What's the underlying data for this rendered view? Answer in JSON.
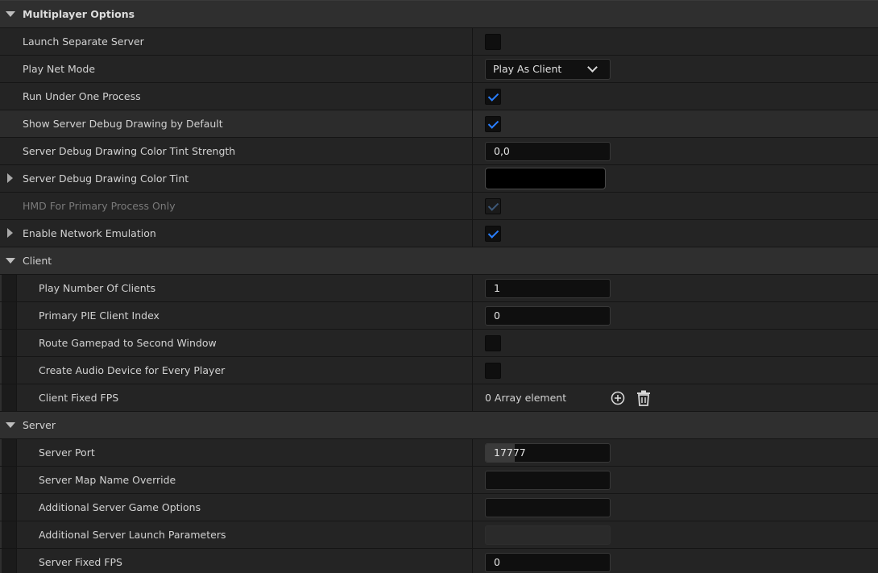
{
  "sections": {
    "multiplayer": {
      "title": "Multiplayer Options",
      "launch_separate_server": {
        "label": "Launch Separate Server",
        "checked": false
      },
      "play_net_mode": {
        "label": "Play Net Mode",
        "value": "Play As Client"
      },
      "run_under_one_process": {
        "label": "Run Under One Process",
        "checked": true
      },
      "show_server_debug_drawing": {
        "label": "Show Server Debug Drawing by Default",
        "checked": true
      },
      "debug_tint_strength": {
        "label": "Server Debug Drawing Color Tint Strength",
        "value": "0,0"
      },
      "debug_tint": {
        "label": "Server Debug Drawing Color Tint",
        "color": "#000000"
      },
      "hmd_primary_only": {
        "label": "HMD For Primary Process Only",
        "checked": true
      },
      "network_emulation": {
        "label": "Enable Network Emulation",
        "checked": true
      }
    },
    "client": {
      "title": "Client",
      "play_number_of_clients": {
        "label": "Play Number Of Clients",
        "value": "1"
      },
      "primary_pie_client_index": {
        "label": "Primary PIE Client Index",
        "value": "0"
      },
      "route_gamepad": {
        "label": "Route Gamepad to Second Window",
        "checked": false
      },
      "create_audio_device": {
        "label": "Create Audio Device for Every Player",
        "checked": false
      },
      "client_fixed_fps": {
        "label": "Client Fixed FPS",
        "value": "0 Array element"
      }
    },
    "server": {
      "title": "Server",
      "server_port": {
        "label": "Server Port",
        "value": "17777"
      },
      "server_map_override": {
        "label": "Server Map Name Override",
        "value": ""
      },
      "additional_game_options": {
        "label": "Additional Server Game Options",
        "value": ""
      },
      "additional_launch_params": {
        "label": "Additional Server Launch Parameters",
        "value": ""
      },
      "server_fixed_fps": {
        "label": "Server Fixed FPS",
        "value": "0"
      }
    }
  },
  "colors": {
    "accent_check": "#2a7fff",
    "row_bg": "#242424",
    "category_bg": "#2f2f2f"
  },
  "icons": {
    "add": "plus-circle-icon",
    "delete": "trash-icon",
    "expand": "triangle-down-icon",
    "collapse": "triangle-right-icon"
  }
}
